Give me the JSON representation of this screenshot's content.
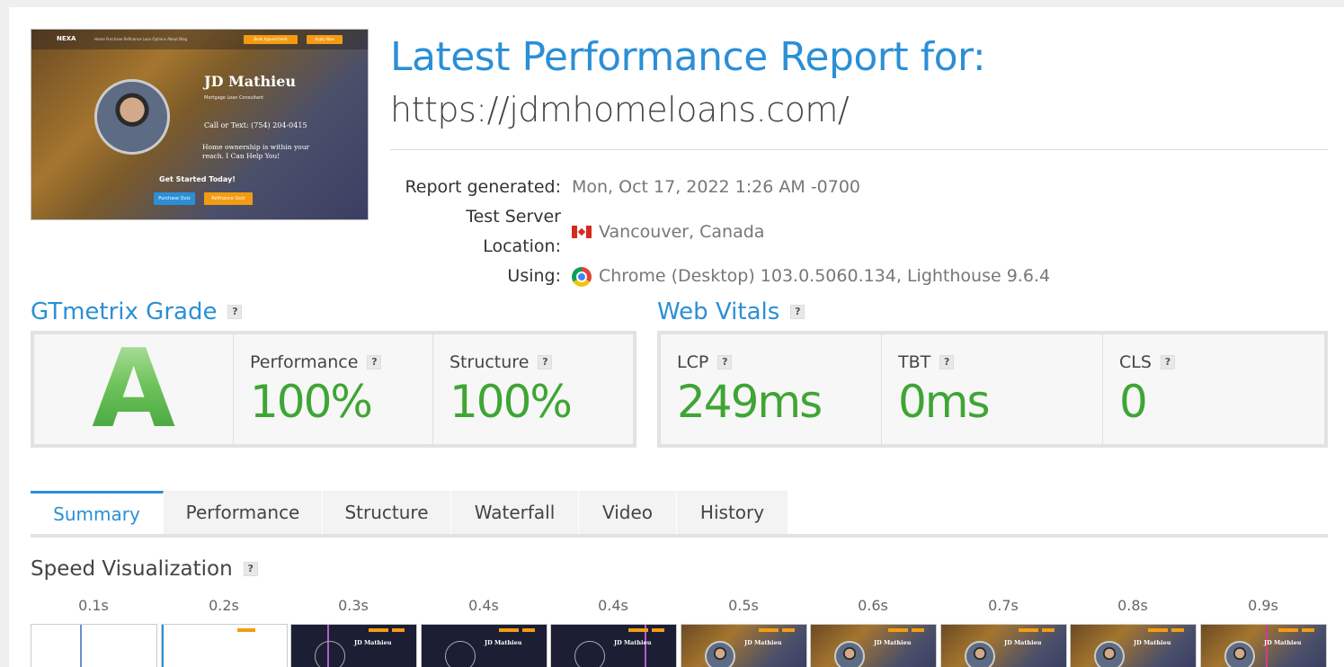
{
  "thumbnail": {
    "logo": "NEXA",
    "nav": "Home   Purchase   Refinance   Loan Options   About   Blog",
    "btn_appointment": "Book Appointment",
    "btn_apply": "Apply Now",
    "name": "JD Mathieu",
    "subtitle": "Mortgage Loan Consultant",
    "phone": "Call or Text: (754) 204-0415",
    "tagline_1": "Home ownership is within your",
    "tagline_2": "reach. I Can Help You!",
    "get_started": "Get Started Today!",
    "btn_purchase": "Purchase Quiz",
    "btn_refinance": "Refinance Quiz"
  },
  "header": {
    "title": "Latest Performance Report for:",
    "url": "https://jdmhomeloans.com/"
  },
  "meta": {
    "generated_label": "Report generated:",
    "generated_value": "Mon, Oct 17, 2022 1:26 AM -0700",
    "location_label": "Test Server Location:",
    "location_value": "Vancouver, Canada",
    "using_label": "Using:",
    "using_value": "Chrome (Desktop) 103.0.5060.134, Lighthouse 9.6.4"
  },
  "grade": {
    "heading": "GTmetrix Grade",
    "letter": "A",
    "performance_label": "Performance",
    "performance_value": "100%",
    "structure_label": "Structure",
    "structure_value": "100%",
    "grade_color": "#4cae3f"
  },
  "vitals": {
    "heading": "Web Vitals",
    "lcp_label": "LCP",
    "lcp_value": "249ms",
    "tbt_label": "TBT",
    "tbt_value": "0ms",
    "cls_label": "CLS",
    "cls_value": "0"
  },
  "help_mark": "?",
  "tabs": [
    "Summary",
    "Performance",
    "Structure",
    "Waterfall",
    "Video",
    "History"
  ],
  "active_tab": "Summary",
  "speed": {
    "heading": "Speed Visualization",
    "frames": [
      "0.1s",
      "0.2s",
      "0.3s",
      "0.4s",
      "0.4s",
      "0.5s",
      "0.6s",
      "0.7s",
      "0.8s",
      "0.9s"
    ],
    "frame_name": "JD Mathieu"
  },
  "colors": {
    "accent": "#2b8fd6",
    "good": "#3fa535"
  }
}
